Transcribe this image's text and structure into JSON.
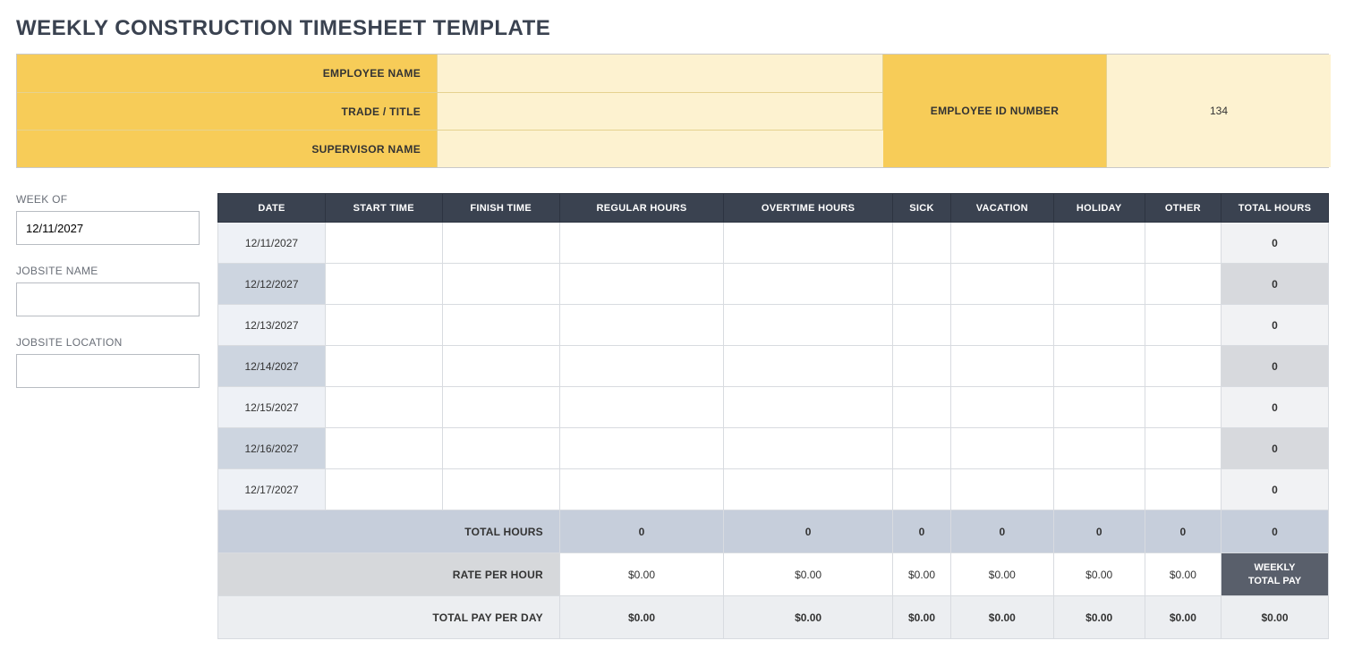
{
  "title": "WEEKLY CONSTRUCTION TIMESHEET TEMPLATE",
  "header": {
    "employee_name_label": "EMPLOYEE NAME",
    "employee_name_value": "",
    "trade_title_label": "TRADE / TITLE",
    "trade_title_value": "",
    "supervisor_name_label": "SUPERVISOR NAME",
    "supervisor_name_value": "",
    "employee_id_label": "EMPLOYEE ID NUMBER",
    "employee_id_value": "134"
  },
  "side": {
    "week_of_label": "WEEK OF",
    "week_of_value": "12/11/2027",
    "jobsite_name_label": "JOBSITE NAME",
    "jobsite_name_value": "",
    "jobsite_location_label": "JOBSITE LOCATION",
    "jobsite_location_value": ""
  },
  "table": {
    "headers": {
      "date": "DATE",
      "start": "START TIME",
      "finish": "FINISH TIME",
      "regular": "REGULAR HOURS",
      "overtime": "OVERTIME HOURS",
      "sick": "SICK",
      "vacation": "VACATION",
      "holiday": "HOLIDAY",
      "other": "OTHER",
      "total": "TOTAL HOURS"
    },
    "rows": [
      {
        "date": "12/11/2027",
        "start": "",
        "finish": "",
        "regular": "",
        "overtime": "",
        "sick": "",
        "vacation": "",
        "holiday": "",
        "other": "",
        "total": "0"
      },
      {
        "date": "12/12/2027",
        "start": "",
        "finish": "",
        "regular": "",
        "overtime": "",
        "sick": "",
        "vacation": "",
        "holiday": "",
        "other": "",
        "total": "0"
      },
      {
        "date": "12/13/2027",
        "start": "",
        "finish": "",
        "regular": "",
        "overtime": "",
        "sick": "",
        "vacation": "",
        "holiday": "",
        "other": "",
        "total": "0"
      },
      {
        "date": "12/14/2027",
        "start": "",
        "finish": "",
        "regular": "",
        "overtime": "",
        "sick": "",
        "vacation": "",
        "holiday": "",
        "other": "",
        "total": "0"
      },
      {
        "date": "12/15/2027",
        "start": "",
        "finish": "",
        "regular": "",
        "overtime": "",
        "sick": "",
        "vacation": "",
        "holiday": "",
        "other": "",
        "total": "0"
      },
      {
        "date": "12/16/2027",
        "start": "",
        "finish": "",
        "regular": "",
        "overtime": "",
        "sick": "",
        "vacation": "",
        "holiday": "",
        "other": "",
        "total": "0"
      },
      {
        "date": "12/17/2027",
        "start": "",
        "finish": "",
        "regular": "",
        "overtime": "",
        "sick": "",
        "vacation": "",
        "holiday": "",
        "other": "",
        "total": "0"
      }
    ],
    "footer": {
      "total_hours_label": "TOTAL HOURS",
      "total_hours": {
        "regular": "0",
        "overtime": "0",
        "sick": "0",
        "vacation": "0",
        "holiday": "0",
        "other": "0",
        "total": "0"
      },
      "rate_label": "RATE PER HOUR",
      "rate": {
        "regular": "$0.00",
        "overtime": "$0.00",
        "sick": "$0.00",
        "vacation": "$0.00",
        "holiday": "$0.00",
        "other": "$0.00"
      },
      "weekly_total_pay_label": "WEEKLY TOTAL PAY",
      "total_pay_label": "TOTAL PAY PER DAY",
      "total_pay": {
        "regular": "$0.00",
        "overtime": "$0.00",
        "sick": "$0.00",
        "vacation": "$0.00",
        "holiday": "$0.00",
        "other": "$0.00",
        "total": "$0.00"
      }
    }
  }
}
